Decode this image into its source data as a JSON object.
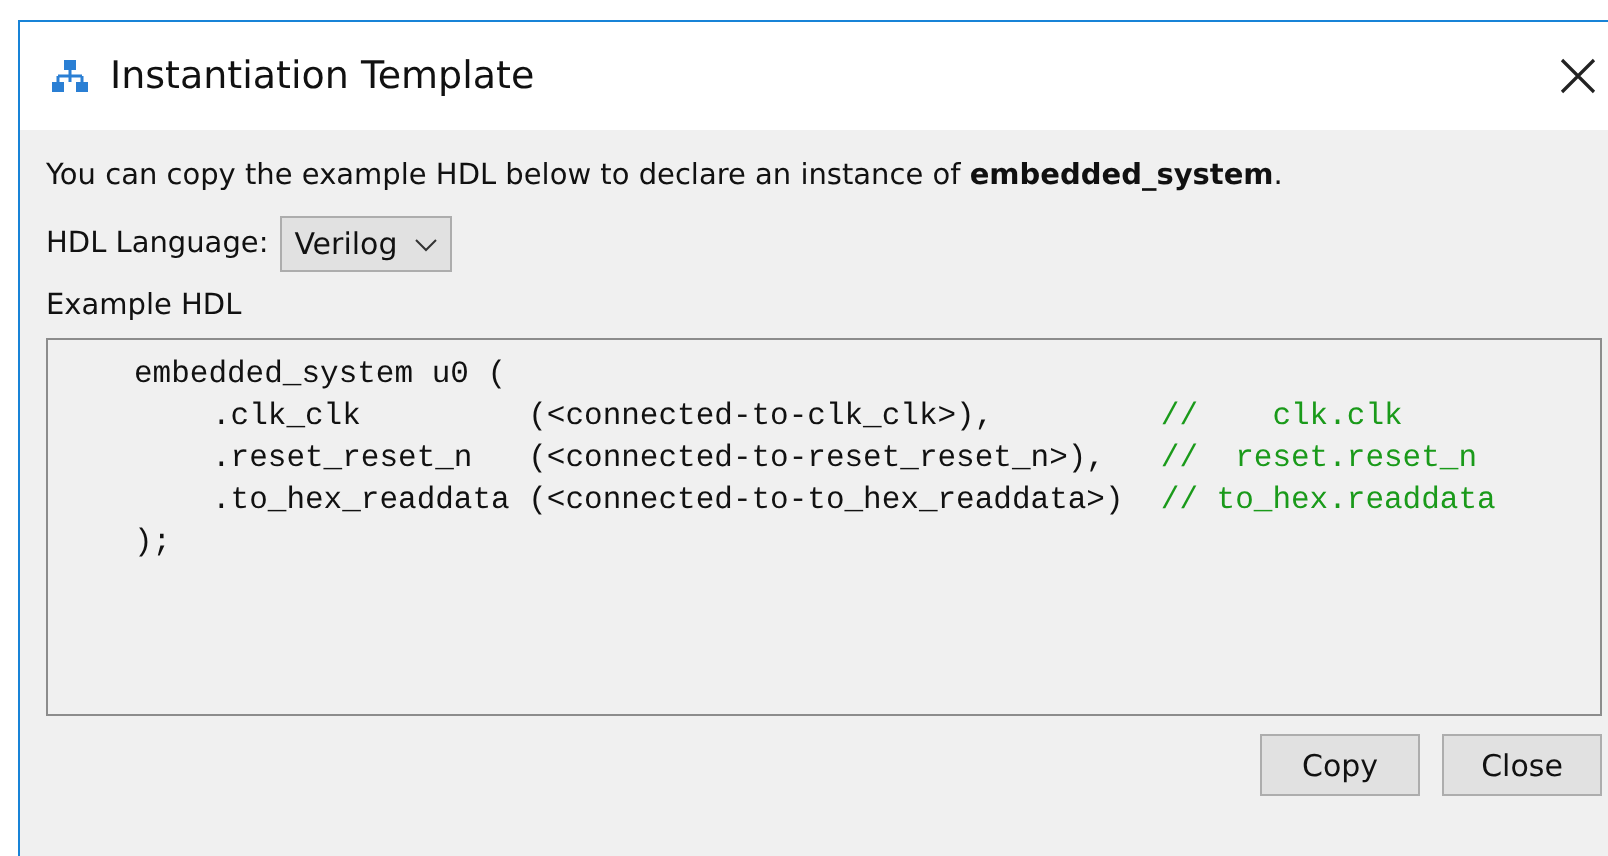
{
  "window": {
    "title": "Instantiation Template"
  },
  "intro": "You can copy the example HDL below to declare an instance of **embedded_system**.",
  "language": {
    "label": "HDL Language:",
    "value": "Verilog"
  },
  "example": {
    "label": "Example HDL",
    "instance": "embedded_system u0 (",
    "ports": [
      {
        "code": ".clk_clk         (<connected-to-clk_clk>),         ",
        "comment": "//    clk.clk"
      },
      {
        "code": ".reset_reset_n   (<connected-to-reset_reset_n>),   ",
        "comment": "//  reset.reset_n"
      },
      {
        "code": ".to_hex_readdata (<connected-to-to_hex_readdata>)  ",
        "comment": "// to_hex.readdata"
      }
    ],
    "closing": ");"
  },
  "buttons": [
    "Copy",
    "Close"
  ]
}
